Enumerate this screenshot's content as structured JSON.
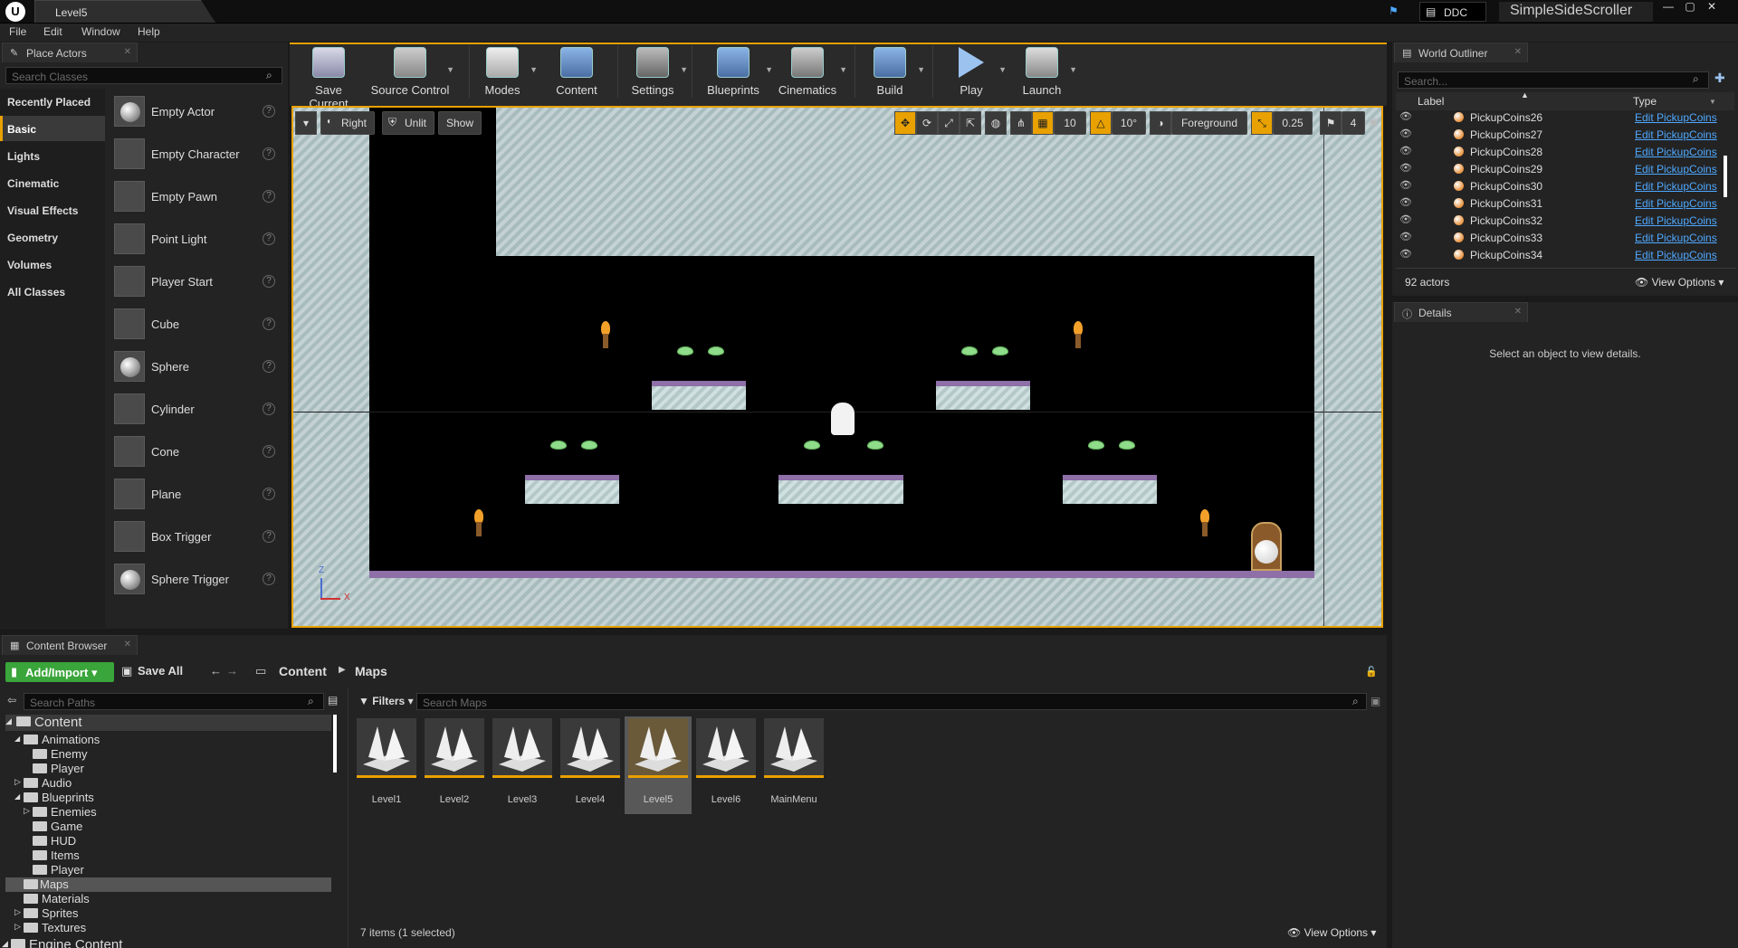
{
  "window": {
    "tab_title": "Level5",
    "ddc_label": "DDC",
    "project_name": "SimpleSideScroller"
  },
  "menu": [
    "File",
    "Edit",
    "Window",
    "Help"
  ],
  "place_actors": {
    "tab_label": "Place Actors",
    "search_placeholder": "Search Classes",
    "categories": [
      "Recently Placed",
      "Basic",
      "Lights",
      "Cinematic",
      "Visual Effects",
      "Geometry",
      "Volumes",
      "All Classes"
    ],
    "selected_category": "Basic",
    "actors": [
      "Empty Actor",
      "Empty Character",
      "Empty Pawn",
      "Point Light",
      "Player Start",
      "Cube",
      "Sphere",
      "Cylinder",
      "Cone",
      "Plane",
      "Box Trigger",
      "Sphere Trigger"
    ]
  },
  "toolbar": {
    "buttons": [
      "Save Current",
      "Source Control",
      "Modes",
      "Content",
      "Settings",
      "Blueprints",
      "Cinematics",
      "Build",
      "Play",
      "Launch"
    ]
  },
  "viewport": {
    "view_mode": "Right",
    "lighting": "Unlit",
    "show": "Show",
    "grid_snap": "10",
    "rotation_snap": "10°",
    "layer": "Foreground",
    "scale_snap": "0.25",
    "camera_speed": "4",
    "axis_z": "Z",
    "axis_x": "X"
  },
  "world_outliner": {
    "tab_label": "World Outliner",
    "search_placeholder": "Search...",
    "col_label": "Label",
    "col_type": "Type",
    "rows": [
      {
        "name": "PickupCoins26",
        "type": "Edit PickupCoins"
      },
      {
        "name": "PickupCoins27",
        "type": "Edit PickupCoins"
      },
      {
        "name": "PickupCoins28",
        "type": "Edit PickupCoins"
      },
      {
        "name": "PickupCoins29",
        "type": "Edit PickupCoins"
      },
      {
        "name": "PickupCoins30",
        "type": "Edit PickupCoins"
      },
      {
        "name": "PickupCoins31",
        "type": "Edit PickupCoins"
      },
      {
        "name": "PickupCoins32",
        "type": "Edit PickupCoins"
      },
      {
        "name": "PickupCoins33",
        "type": "Edit PickupCoins"
      },
      {
        "name": "PickupCoins34",
        "type": "Edit PickupCoins"
      }
    ],
    "actor_count": "92 actors",
    "view_options": "View Options"
  },
  "details": {
    "tab_label": "Details",
    "empty_message": "Select an object to view details."
  },
  "content_browser": {
    "tab_label": "Content Browser",
    "add_import": "Add/Import",
    "save_all": "Save All",
    "path": [
      "Content",
      "Maps"
    ],
    "search_paths_placeholder": "Search Paths",
    "filters": "Filters",
    "search_maps_placeholder": "Search Maps",
    "tree": [
      {
        "label": "Content",
        "depth": 0
      },
      {
        "label": "Animations",
        "depth": 1
      },
      {
        "label": "Enemy",
        "depth": 2
      },
      {
        "label": "Player",
        "depth": 2
      },
      {
        "label": "Audio",
        "depth": 1
      },
      {
        "label": "Blueprints",
        "depth": 1
      },
      {
        "label": "Enemies",
        "depth": 2
      },
      {
        "label": "Game",
        "depth": 2
      },
      {
        "label": "HUD",
        "depth": 2
      },
      {
        "label": "Items",
        "depth": 2
      },
      {
        "label": "Player",
        "depth": 2
      },
      {
        "label": "Maps",
        "depth": 1
      },
      {
        "label": "Materials",
        "depth": 1
      },
      {
        "label": "Sprites",
        "depth": 1
      },
      {
        "label": "Textures",
        "depth": 1
      },
      {
        "label": "Engine Content",
        "depth": 0
      }
    ],
    "assets": [
      "Level1",
      "Level2",
      "Level3",
      "Level4",
      "Level5",
      "Level6",
      "MainMenu"
    ],
    "selected_asset": "Level5",
    "item_count": "7 items (1 selected)",
    "view_options": "View Options"
  }
}
